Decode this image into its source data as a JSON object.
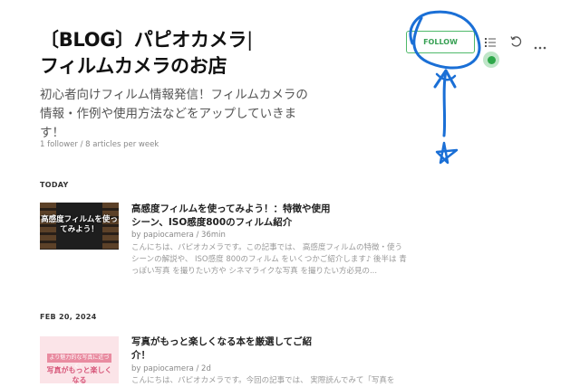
{
  "blog": {
    "title_line1": "〔BLOG〕パピオカメラ",
    "title_line2": "フィルムカメラのお店",
    "description": "初心者向けフィルム情報発信！フィルムカメラの情報・作例や使用方法などをアップしていきます！",
    "meta": "1 follower / 8 articles per week"
  },
  "header": {
    "follow_label": "FOLLOW",
    "icons": [
      "list-icon",
      "refresh-icon",
      "more-icon"
    ]
  },
  "sections": [
    {
      "label": "TODAY",
      "article": {
        "title": "高感度フィルムを使ってみよう！：特徴や使用シーン、ISO感度800のフィルム紹介",
        "meta": "by papiocamera / 36min",
        "excerpt": "こんにちは、パピオカメラです。この記事では、 高感度フィルムの特徴・使うシーンの解説や、 ISO感度 800のフィルム をいくつかご紹介します♪ 後半は 青っぽい写真 を撮りたい方や シネマライクな写真 を撮りたい方必見の...",
        "thumb_text": "高感度フィルムを使ってみよう！"
      }
    },
    {
      "label": "FEB 20, 2024",
      "article": {
        "title": "写真がもっと楽しくなる本を厳選してご紹介！",
        "meta": "by papiocamera / 2d",
        "excerpt": "こんにちは、パピオカメラです。今回の記事では、 実際読んでみて「写真を",
        "thumb_top": "より魅力的な写真に近づく！",
        "thumb_bottom": "写真がもっと楽しくなる"
      }
    }
  ],
  "colors": {
    "accent": "#39a155",
    "annotation": "#1a6fd6"
  }
}
